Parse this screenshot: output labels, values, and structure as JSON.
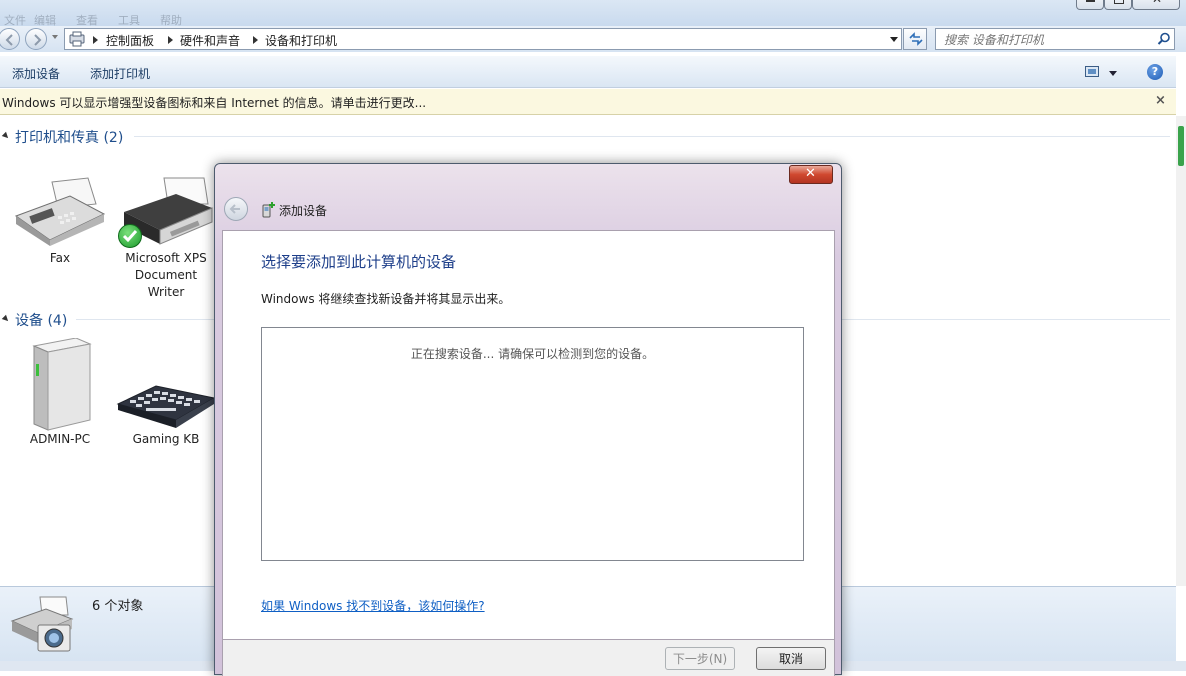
{
  "window": {
    "menu_ghost": [
      "文件",
      "编辑",
      "查看",
      "工具",
      "帮助"
    ]
  },
  "navbar": {
    "breadcrumbs": [
      "控制面板",
      "硬件和声音",
      "设备和打印机"
    ],
    "search_placeholder": "搜索 设备和打印机"
  },
  "commandbar": {
    "add_device": "添加设备",
    "add_printer": "添加打印机"
  },
  "infobar": {
    "message": "Windows 可以显示增强型设备图标和来自 Internet 的信息。请单击进行更改..."
  },
  "groups": [
    {
      "header": "打印机和传真 (2)",
      "items": [
        {
          "label": "Fax",
          "icon": "fax-icon"
        },
        {
          "label": "Microsoft XPS Document Writer",
          "icon": "printer-icon",
          "default": true
        }
      ]
    },
    {
      "header": "设备 (4)",
      "items": [
        {
          "label": "ADMIN-PC",
          "icon": "computer-tower-icon"
        },
        {
          "label": "Gaming KB",
          "icon": "keyboard-icon"
        }
      ]
    }
  ],
  "details": {
    "count": "6 个对象"
  },
  "dialog": {
    "title": "添加设备",
    "heading": "选择要添加到此计算机的设备",
    "description": "Windows 将继续查找新设备并将其显示出来。",
    "status": "正在搜索设备... 请确保可以检测到您的设备。",
    "help_link": "如果 Windows 找不到设备，该如何操作?",
    "next_button": "下一步(N)",
    "cancel_button": "取消"
  }
}
